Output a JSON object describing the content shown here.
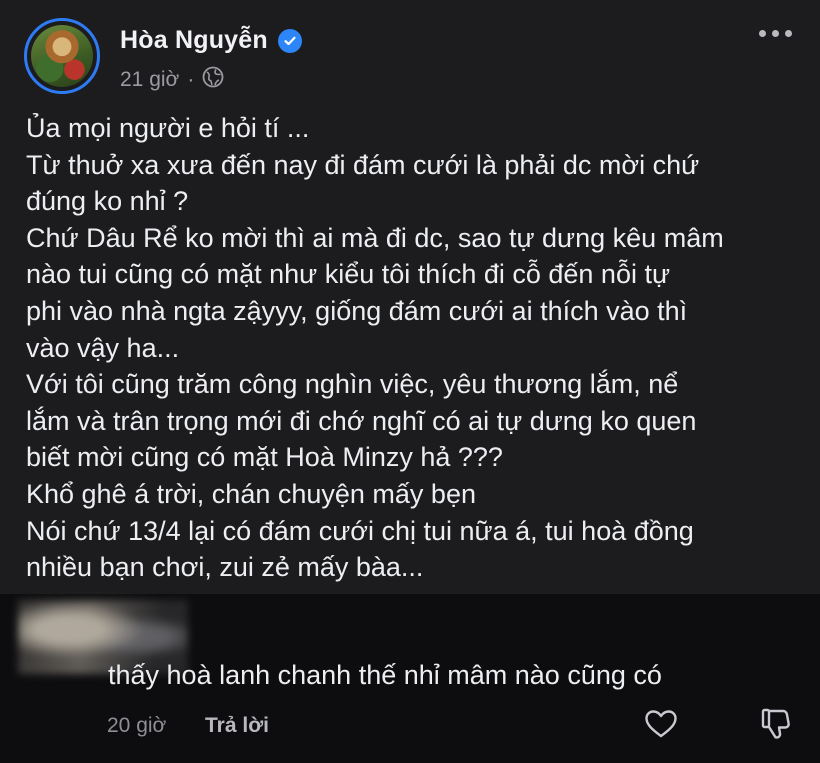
{
  "post": {
    "author": "Hòa Nguyễn",
    "verified": true,
    "time": "21 giờ",
    "separator": "·",
    "privacy_icon": "globe-icon",
    "more_icon": "more-horizontal-icon",
    "lines": [
      "Ủa mọi người e hỏi tí ...",
      "Từ thuở xa xưa đến nay đi đám cưới là phải dc mời chứ",
      "đúng ko nhỉ ?",
      "Chứ Dâu Rể ko mời thì ai mà đi dc, sao tự dưng kêu mâm",
      "nào tui cũng có mặt như kiểu tôi thích đi cỗ đến nỗi tự",
      "phi vào nhà ngta zậyyy, giống đám cưới ai thích vào thì",
      "vào vậy ha...",
      "Với tôi cũng trăm công nghìn việc, yêu thương lắm, nể",
      "lắm và trân trọng mới đi chớ nghĩ có ai tự dưng ko quen",
      "biết mời cũng có mặt Hoà Minzy hả ???",
      "Khổ ghê á trời, chán chuyện mấy bẹn",
      "Nói chứ 13/4 lại có đám cưới chị tui nữa á, tui hoà đồng",
      "nhiều bạn chơi, zui zẻ mấy bàa..."
    ]
  },
  "comment": {
    "text": "thấy hoà lanh chanh thế nhỉ mâm nào cũng có",
    "time": "20 giờ",
    "reply_label": "Trả lời",
    "like_icon": "heart-icon",
    "dislike_icon": "thumbs-down-icon"
  },
  "colors": {
    "post_bg": "#1c1c1e",
    "page_bg": "#0d0d0f",
    "accent": "#2d86f7",
    "muted": "#9a9ba1"
  }
}
